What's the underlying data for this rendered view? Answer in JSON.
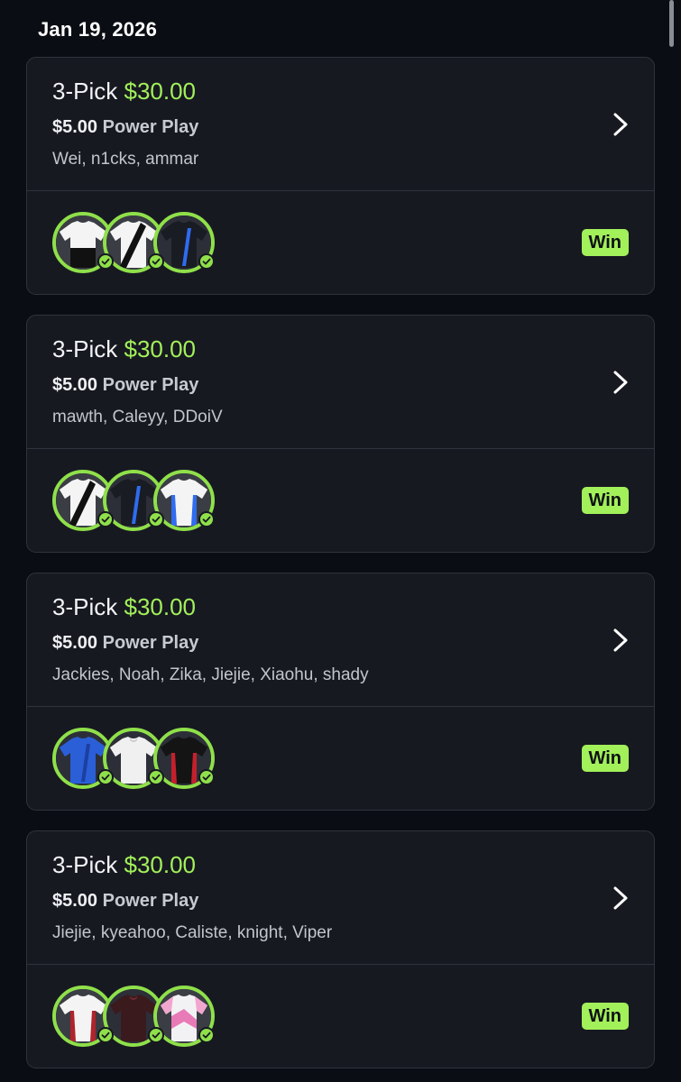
{
  "date_header": "Jan 19, 2026",
  "cards": [
    {
      "pick_label": "3-Pick",
      "payout": "$30.00",
      "entry_amount": "$5.00",
      "play_type": "Power Play",
      "players": "Wei, n1cks, ammar",
      "avatars": [
        "jersey-white-black-icon",
        "jersey-white-sash-icon",
        "jersey-black-blue-icon"
      ],
      "result": "Win"
    },
    {
      "pick_label": "3-Pick",
      "payout": "$30.00",
      "entry_amount": "$5.00",
      "play_type": "Power Play",
      "players": "mawth, Caleyy, DDoiV",
      "avatars": [
        "jersey-white-sash-icon",
        "jersey-black-blue-icon",
        "jersey-white-blue-icon"
      ],
      "result": "Win"
    },
    {
      "pick_label": "3-Pick",
      "payout": "$30.00",
      "entry_amount": "$5.00",
      "play_type": "Power Play",
      "players": "Jackies, Noah, Zika, Jiejie, Xiaohu, shady",
      "avatars": [
        "jersey-blue-icon",
        "jersey-white-pair-icon",
        "jersey-black-red-icon"
      ],
      "result": "Win"
    },
    {
      "pick_label": "3-Pick",
      "payout": "$30.00",
      "entry_amount": "$5.00",
      "play_type": "Power Play",
      "players": "Jiejie, kyeahoo, Caliste, knight, Viper",
      "avatars": [
        "jersey-white-red-icon",
        "jersey-maroon-icon",
        "jersey-pink-white-icon"
      ],
      "result": "Win"
    }
  ],
  "colors": {
    "background": "#0b0d14",
    "card": "#171921",
    "accent_green": "#a2f05a",
    "ring_green": "#8fe04a"
  }
}
